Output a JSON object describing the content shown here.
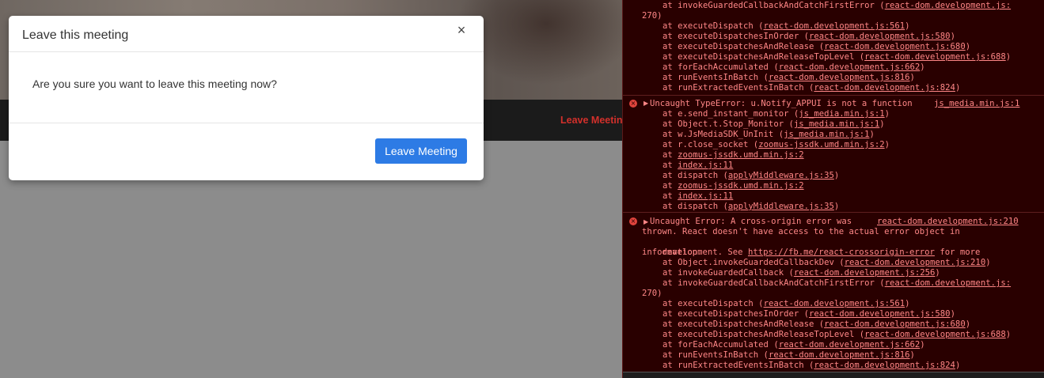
{
  "modal": {
    "title": "Leave this meeting",
    "close": "×",
    "message": "Are you sure you want to leave this meeting now?",
    "leave_button": "Leave Meeting"
  },
  "footer_bar": {
    "leave_link": "Leave Meetin"
  },
  "console": {
    "block1": [
      {
        "prefix": "at invokeGuardedCallbackAndCatchFirstError (",
        "link": "react-dom.development.js:",
        "suffix": ""
      },
      {
        "wrap": "270)"
      },
      {
        "prefix": "at executeDispatch (",
        "link": "react-dom.development.js:561",
        "suffix": ")"
      },
      {
        "prefix": "at executeDispatchesInOrder (",
        "link": "react-dom.development.js:580",
        "suffix": ")"
      },
      {
        "prefix": "at executeDispatchesAndRelease (",
        "link": "react-dom.development.js:680",
        "suffix": ")"
      },
      {
        "prefix": "at executeDispatchesAndReleaseTopLevel (",
        "link": "react-dom.development.js:688",
        "suffix": ")"
      },
      {
        "prefix": "at forEachAccumulated (",
        "link": "react-dom.development.js:662",
        "suffix": ")"
      },
      {
        "prefix": "at runEventsInBatch (",
        "link": "react-dom.development.js:816",
        "suffix": ")"
      },
      {
        "prefix": "at runExtractedEventsInBatch (",
        "link": "react-dom.development.js:824",
        "suffix": ")"
      }
    ],
    "error2": {
      "icon": "×",
      "message": "Uncaught TypeError: u.Notify_APPUI is not a function",
      "source": "js_media.min.js:1",
      "stack": [
        {
          "prefix": "at e.send_instant_monitor (",
          "link": "js_media.min.js:1",
          "suffix": ")"
        },
        {
          "prefix": "at Object.t.Stop_Monitor (",
          "link": "js_media.min.js:1",
          "suffix": ")"
        },
        {
          "prefix": "at w.JsMediaSDK_UnInit (",
          "link": "js_media.min.js:1",
          "suffix": ")"
        },
        {
          "prefix": "at r.close_socket (",
          "link": "zoomus-jssdk.umd.min.js:2",
          "suffix": ")"
        },
        {
          "prefix": "at ",
          "link": "zoomus-jssdk.umd.min.js:2",
          "suffix": ""
        },
        {
          "prefix": "at ",
          "link": "index.js:11",
          "suffix": ""
        },
        {
          "prefix": "at dispatch (",
          "link": "applyMiddleware.js:35",
          "suffix": ")"
        },
        {
          "prefix": "at ",
          "link": "zoomus-jssdk.umd.min.js:2",
          "suffix": ""
        },
        {
          "prefix": "at ",
          "link": "index.js:11",
          "suffix": ""
        },
        {
          "prefix": "at dispatch (",
          "link": "applyMiddleware.js:35",
          "suffix": ")"
        }
      ]
    },
    "error3": {
      "icon": "×",
      "message_line1": "Uncaught Error: A cross-origin error was",
      "source": "react-dom.development.js:210",
      "message_line2": "thrown. React doesn't have access to the actual error object in",
      "message_line3_prefix": "development. See ",
      "message_line3_link": "https://fb.me/react-crossorigin-error",
      "message_line3_suffix": " for more",
      "message_line4": "information.",
      "stack": [
        {
          "prefix": "at Object.invokeGuardedCallbackDev (",
          "link": "react-dom.development.js:210",
          "suffix": ")"
        },
        {
          "prefix": "at invokeGuardedCallback (",
          "link": "react-dom.development.js:256",
          "suffix": ")"
        },
        {
          "prefix": "at invokeGuardedCallbackAndCatchFirstError (",
          "link": "react-dom.development.js:",
          "suffix": ""
        },
        {
          "wrap": "270)"
        },
        {
          "prefix": "at executeDispatch (",
          "link": "react-dom.development.js:561",
          "suffix": ")"
        },
        {
          "prefix": "at executeDispatchesInOrder (",
          "link": "react-dom.development.js:580",
          "suffix": ")"
        },
        {
          "prefix": "at executeDispatchesAndRelease (",
          "link": "react-dom.development.js:680",
          "suffix": ")"
        },
        {
          "prefix": "at executeDispatchesAndReleaseTopLevel (",
          "link": "react-dom.development.js:688",
          "suffix": ")"
        },
        {
          "prefix": "at forEachAccumulated (",
          "link": "react-dom.development.js:662",
          "suffix": ")"
        },
        {
          "prefix": "at runEventsInBatch (",
          "link": "react-dom.development.js:816",
          "suffix": ")"
        },
        {
          "prefix": "at runExtractedEventsInBatch (",
          "link": "react-dom.development.js:824",
          "suffix": ")"
        }
      ]
    }
  }
}
